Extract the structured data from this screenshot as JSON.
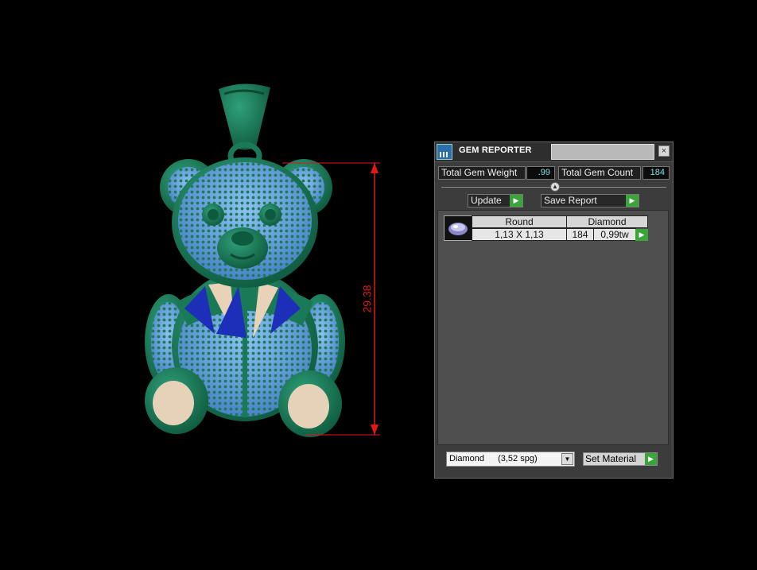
{
  "viewport": {
    "dimension_label": "29.38",
    "colors": {
      "model_green": "#1a7a57",
      "gems_blue": "#6aa8e8",
      "dimension_red": "#e01818"
    }
  },
  "panel": {
    "title": "GEM REPORTER",
    "close_glyph": "×",
    "total_gem_weight_label": "Total Gem Weight",
    "total_gem_weight_value": ".99",
    "total_gem_count_label": "Total Gem Count",
    "total_gem_count_value": "184",
    "update_label": "Update",
    "save_report_label": "Save Report",
    "table": {
      "headers": [
        "Round",
        "Diamond"
      ],
      "rows": [
        {
          "size": "1,13 X 1,13",
          "count": "184",
          "weight": "0,99tw"
        }
      ]
    },
    "material_select": {
      "name": "Diamond",
      "density": "(3,52 spg)"
    },
    "set_material_label": "Set Material"
  }
}
